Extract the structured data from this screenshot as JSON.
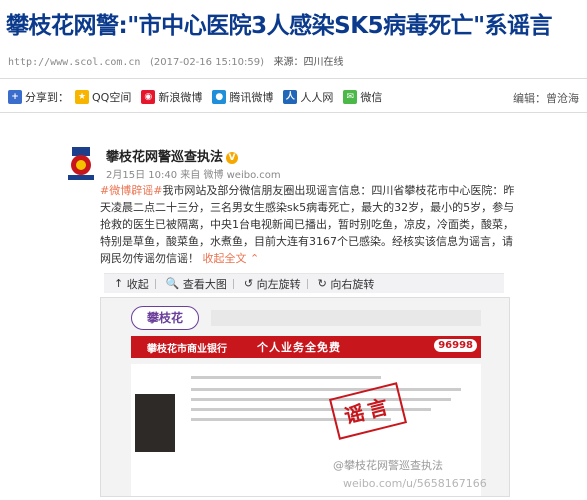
{
  "article": {
    "title": "攀枝花网警:\"市中心医院3人感染SK5病毒死亡\"系谣言",
    "url": "http://www.scol.com.cn",
    "datetime": "(2017-02-16 15:10:59)",
    "source": "来源：四川在线"
  },
  "share": {
    "label": "分享到：",
    "targets": [
      {
        "label": "QQ空间",
        "icon": "qzone-icon",
        "color": "#f7b500"
      },
      {
        "label": "新浪微博",
        "icon": "weibo-icon",
        "color": "#e6162d"
      },
      {
        "label": "腾讯微博",
        "icon": "tencent-weibo-icon",
        "color": "#1e8fd8"
      },
      {
        "label": "人人网",
        "icon": "renren-icon",
        "color": "#2266b8"
      },
      {
        "label": "微信",
        "icon": "wechat-icon",
        "color": "#4cb848"
      }
    ]
  },
  "editor": "编辑：曾沧海",
  "weibo": {
    "account": "攀枝花网警巡查执法",
    "verified": "V",
    "time": "2月15日 10:40 来自 微博 weibo.com",
    "tag": "#微博辟谣#",
    "text": "我市网站及部分微信朋友圈出现谣言信息：四川省攀枝花市中心医院：昨天凌晨二点二十三分，三名男女生感染sk5病毒死亡，最大的32岁，最小的5岁，参与抢救的医生已被隔离，中央1台电视新闻已播出，暂时别吃鱼，凉皮，冷面类，酸菜，特别是草鱼，酸菜鱼，水煮鱼，目前大连有3167个已感染。经核实该信息为谣言，请网民勿传谣勿信谣！",
    "collapse": "收起全文 ⌃",
    "tools": [
      "收起",
      "查看大图",
      "向左旋转",
      "向右旋转"
    ],
    "image": {
      "site_logo": "攀枝花",
      "bank": "攀枝花市商业银行",
      "business": "个人业务全免费",
      "hotline": "96998",
      "stamp": "谣言"
    },
    "watermark_line1": "@攀枝花网警巡查执法",
    "watermark_line2": "weibo.com/u/5658167166"
  }
}
